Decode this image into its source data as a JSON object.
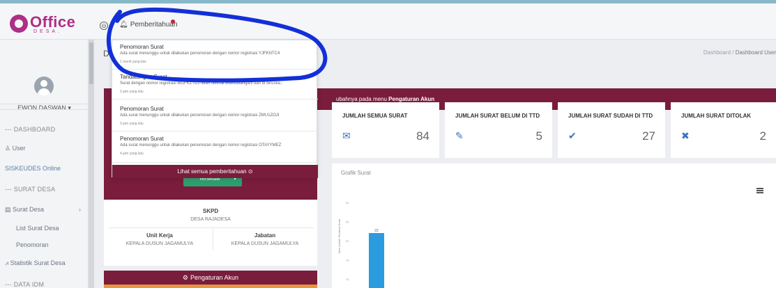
{
  "header": {
    "logo_text": "Office",
    "logo_sub": "DESA.",
    "notification_label": "Pemberitahuan"
  },
  "sidebar": {
    "username": "EWON DASWAN ▾",
    "items": [
      {
        "label": "--- DASHBOARD"
      },
      {
        "label": "User"
      },
      {
        "label": "SISKEUDES Online"
      },
      {
        "label": "--- SURAT DESA"
      },
      {
        "label": "Surat Desa"
      },
      {
        "label": "List Surat Desa"
      },
      {
        "label": "Penomoran"
      },
      {
        "label": "Statistik Surat Desa"
      },
      {
        "label": "--- DATA IDM"
      }
    ]
  },
  "main": {
    "page_title": "D",
    "breadcrumb": {
      "home": "Dashboard",
      "sep": "/",
      "current": "Dashboard User"
    },
    "alert": {
      "text": "ubahnya pada menu ",
      "bold": "Pengaturan Akun"
    },
    "status_button": "Tersedia"
  },
  "profile": {
    "skpd_label": "SKPD",
    "skpd_value": "DESA RAJADESA",
    "unit_label": "Unit Kerja",
    "unit_value": "KEPALA DUSUN JAGAMULYA",
    "jabatan_label": "Jabatan",
    "jabatan_value": "KEPALA DUSUN JAGAMULYA",
    "settings_label": "Pengaturan Akun"
  },
  "stats": [
    {
      "title": "JUMLAH SEMUA SURAT",
      "value": "84",
      "icon": "envelope-icon",
      "color": "#3a72c4"
    },
    {
      "title": "JUMLAH SURAT BELUM DI TTD",
      "value": "5",
      "icon": "pencil-icon",
      "color": "#3a72c4"
    },
    {
      "title": "JUMLAH SURAT SUDAH DI TTD",
      "value": "27",
      "icon": "check-icon",
      "color": "#3a72c4"
    },
    {
      "title": "JUMLAH SURAT DITOLAK",
      "value": "2",
      "icon": "x-icon",
      "color": "#3a72c4"
    }
  ],
  "chart": {
    "title": "Grafik Surat"
  },
  "chart_data": {
    "type": "bar",
    "title": "Grafik Surat",
    "ylabel": "Total Jumlah Pembuat Surat",
    "ylim": [
      10,
      30
    ],
    "yticks": [
      "30",
      "25",
      "20",
      "15",
      "10"
    ],
    "values": [
      22
    ],
    "data_labels": [
      "22"
    ],
    "bar_color": "#2b9be0"
  },
  "notifications": {
    "items": [
      {
        "title": "Penomoran Surat",
        "body": "Ada surat menunggu untuk dilakukan penomoran dengan nomor registrasi YJFKNTC4",
        "time": "1 menit yang lalu"
      },
      {
        "title": "Tandatangan Surat",
        "body": "Surat dengan nomor registrasi MGFKZTDJ telah selesai ditandatangani dan di teruska..",
        "time": "2 jam yang lalu"
      },
      {
        "title": "Penomoran Surat",
        "body": "Ada surat menunggu untuk dilakukan penomoran dengan nomor registrasi ZMU1ZOJI",
        "time": "3 jam yang lalu"
      },
      {
        "title": "Penomoran Surat",
        "body": "Ada surat menunggu untuk dilakukan penomoran dengan nomor registrasi OTAYYMEZ",
        "time": "4 jam yang lalu"
      }
    ],
    "see_all": "Lihat semua pemberitahuan"
  },
  "colors": {
    "brand": "#ad2f86",
    "maroon": "#7a1c3c",
    "annotation": "#1230d8"
  }
}
